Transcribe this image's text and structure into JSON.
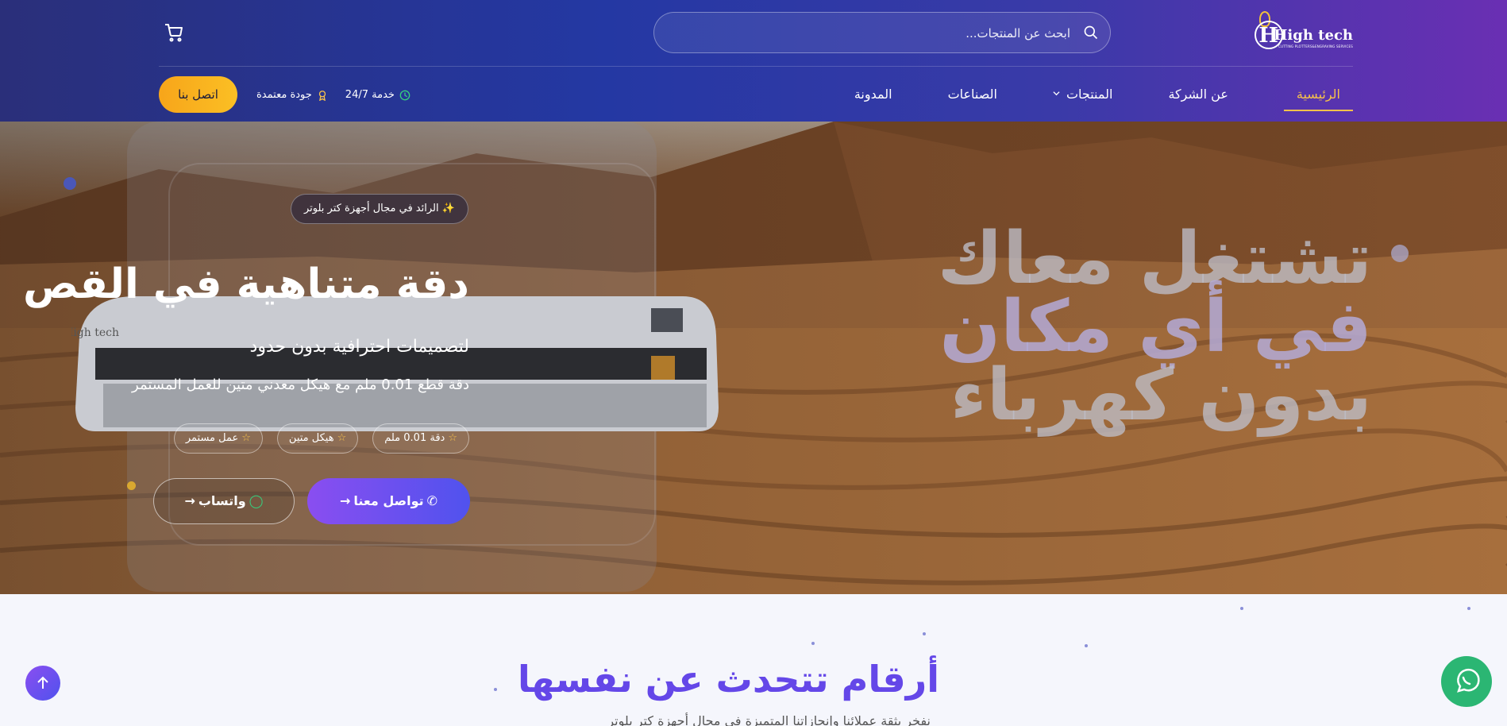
{
  "header": {
    "logo": {
      "name": "High tech",
      "mark": "H",
      "tagline": "CUTTING PLOTTERS&ENGRAVING SERVICES"
    },
    "search": {
      "placeholder": "ابحث عن المنتجات..."
    },
    "nav": [
      {
        "label": "الرئيسية",
        "active": true
      },
      {
        "label": "عن الشركة",
        "active": false
      },
      {
        "label": "المنتجات",
        "active": false,
        "dropdown": true
      },
      {
        "label": "الصناعات",
        "active": false
      },
      {
        "label": "المدونة",
        "active": false
      }
    ],
    "features": [
      {
        "label": "جودة معتمدة",
        "icon": "award-icon"
      },
      {
        "label": "خدمة 24/7",
        "icon": "clock-icon"
      }
    ],
    "contact_button": "اتصل بنا",
    "colors": {
      "accent": "#f7c14b",
      "header_start": "#2a2f7a",
      "header_end": "#6a2fb3"
    }
  },
  "hero": {
    "badge": "الرائد في مجال أجهزة كتر بلوتر",
    "title": "دقة متناهية في القص",
    "subtitle": "لتصميمات احترافية بدون حدود",
    "description": "دقة قطع 0.01 ملم مع هيكل معدني متين للعمل المستمر",
    "tags": [
      "دقة 0.01 ملم",
      "هيكل متين",
      "عمل مستمر"
    ],
    "buttons": {
      "contact": "تواصل معنا",
      "whatsapp": "واتساب"
    },
    "big_text": {
      "line1": "تشتغل معاك",
      "line2": "في أي مكان",
      "line3": "بدون كهرباء"
    }
  },
  "stats": {
    "title": "أرقام تتحدث عن نفسها",
    "subtitle": "نفخر بثقة عملائنا وإنجازاتنا المتميزة في مجال أجهزة كتر بلوتر"
  }
}
